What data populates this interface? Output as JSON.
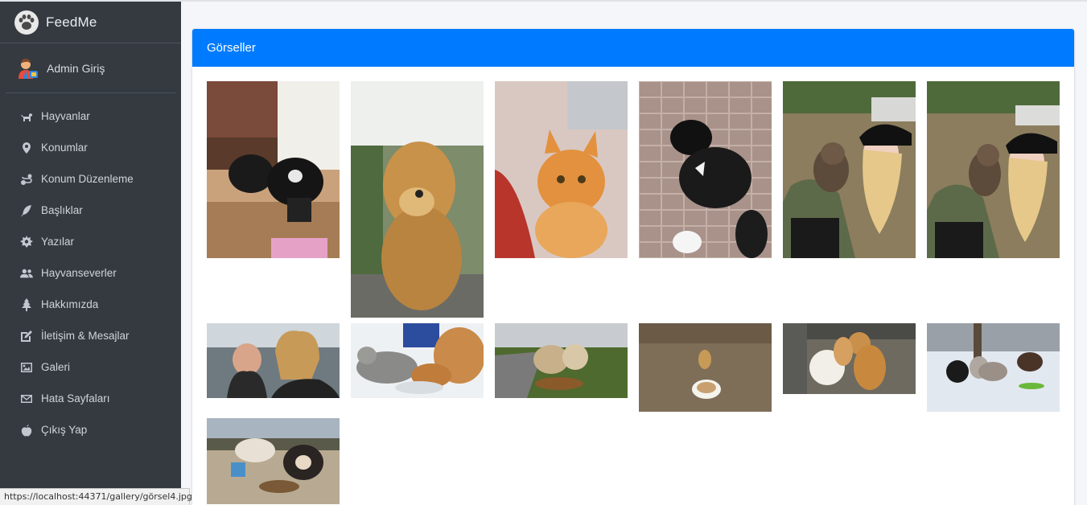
{
  "brand": {
    "name": "FeedMe",
    "icon": "paw-icon"
  },
  "user": {
    "label": "Admin Giriş",
    "icon": "admin-avatar-icon"
  },
  "nav": [
    {
      "label": "Hayvanlar",
      "icon": "dog-icon"
    },
    {
      "label": "Konumlar",
      "icon": "map-marker-icon"
    },
    {
      "label": "Konum Düzenleme",
      "icon": "route-icon"
    },
    {
      "label": "Başlıklar",
      "icon": "feather-icon"
    },
    {
      "label": "Yazılar",
      "icon": "sun-gear-icon"
    },
    {
      "label": "Hayvanseverler",
      "icon": "users-icon"
    },
    {
      "label": "Hakkımızda",
      "icon": "tree-icon"
    },
    {
      "label": "İletişim & Mesajlar",
      "icon": "edit-icon"
    },
    {
      "label": "Galeri",
      "icon": "image-icon"
    },
    {
      "label": "Hata Sayfaları",
      "icon": "envelope-icon"
    },
    {
      "label": "Çıkış Yap",
      "icon": "apple-icon"
    }
  ],
  "gallery": {
    "title": "Görseller",
    "photos": [
      "puppies-on-deck",
      "golden-retriever",
      "orange-kitten",
      "black-puppy-on-paving",
      "woman-with-puppy",
      "woman-with-puppy-2",
      "two-women-selfie",
      "cat-and-dog-eating-snow",
      "dogs-eating-roadside",
      "puppy-with-food-bowl",
      "dogs-behind-fence",
      "dogs-in-snow",
      "dogs-eating-outdoors"
    ]
  },
  "status": {
    "url": "https://localhost:44371/gallery/görsel4.jpg"
  },
  "colors": {
    "sidebar": "#343a40",
    "header": "#007bff",
    "background": "#f4f6f9"
  }
}
